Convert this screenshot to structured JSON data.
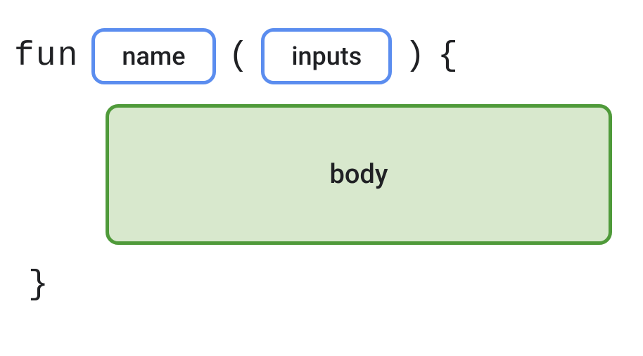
{
  "syntax": {
    "keyword": "fun",
    "open_paren": "(",
    "close_paren": ")",
    "open_brace": "{",
    "close_brace": "}"
  },
  "slots": {
    "name": "name",
    "inputs": "inputs",
    "body": "body"
  },
  "colors": {
    "blue_border": "#5b8def",
    "green_border": "#4f9a3a",
    "green_fill": "#d8e8cd"
  }
}
